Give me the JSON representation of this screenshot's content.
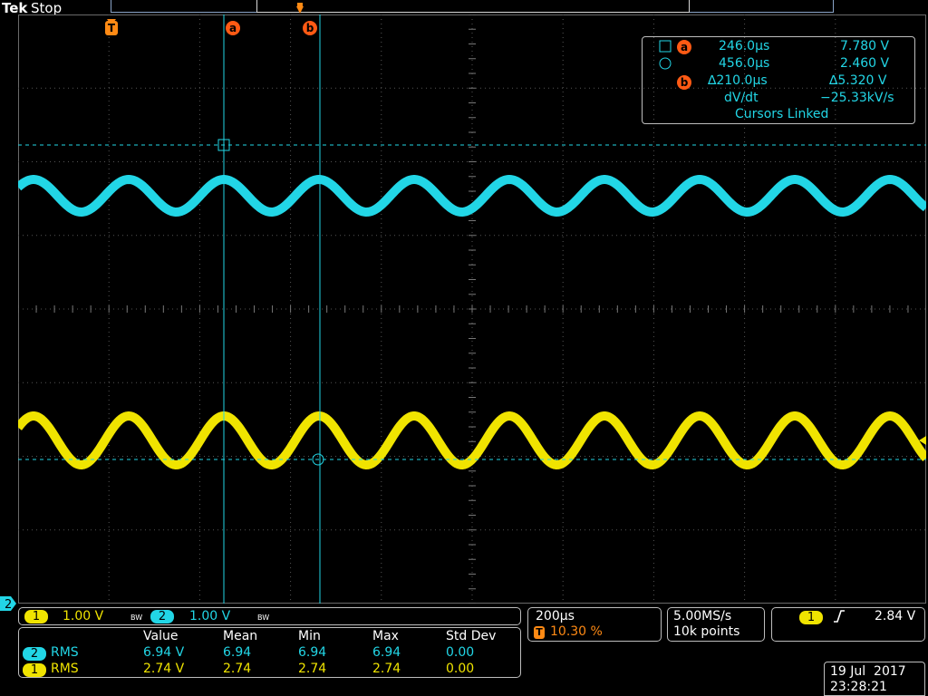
{
  "header": {
    "brand": "Tek",
    "run_state": "Stop"
  },
  "cursors": {
    "a_label": "a",
    "b_label": "b",
    "trigger_label": "T"
  },
  "readout": {
    "row1": {
      "time": "246.0µs",
      "volt": "7.780 V"
    },
    "row2": {
      "time": "456.0µs",
      "volt": "2.460 V"
    },
    "row3": {
      "time": "∆210.0µs",
      "volt": "∆5.320 V"
    },
    "row4": {
      "label": "dV/dt",
      "value": "−25.33kV/s"
    },
    "linked": "Cursors Linked"
  },
  "channels": {
    "ch1": {
      "num": "1",
      "scale": "1.00 V",
      "color": "#f0e400"
    },
    "ch2": {
      "num": "2",
      "scale": "1.00 V",
      "color": "#22d6e6"
    },
    "bw_mark": "BW",
    "ground_marker": "2"
  },
  "timebase": {
    "scale": "200µs",
    "trigger_pos": "10.30 %",
    "sample_rate": "5.00MS/s",
    "record": "10k points"
  },
  "trigger": {
    "source": "1",
    "slope": "∕",
    "level": "2.84 V"
  },
  "measurements": {
    "headers": [
      "Value",
      "Mean",
      "Min",
      "Max",
      "Std Dev"
    ],
    "rows": [
      {
        "ch": "2",
        "type": "RMS",
        "value": "6.94 V",
        "mean": "6.94",
        "min": "6.94",
        "max": "6.94",
        "std": "0.00"
      },
      {
        "ch": "1",
        "type": "RMS",
        "value": "2.74 V",
        "mean": "2.74",
        "min": "2.74",
        "max": "2.74",
        "std": "0.00"
      }
    ]
  },
  "datetime": {
    "date": "19 Jul  2017",
    "time": "23:28:21"
  },
  "colors": {
    "ch1": "#f0e400",
    "ch2": "#22d6e6",
    "cursor": "#22d6e6",
    "grid": "#5a5a5a",
    "marker": "#ff5a14"
  }
}
